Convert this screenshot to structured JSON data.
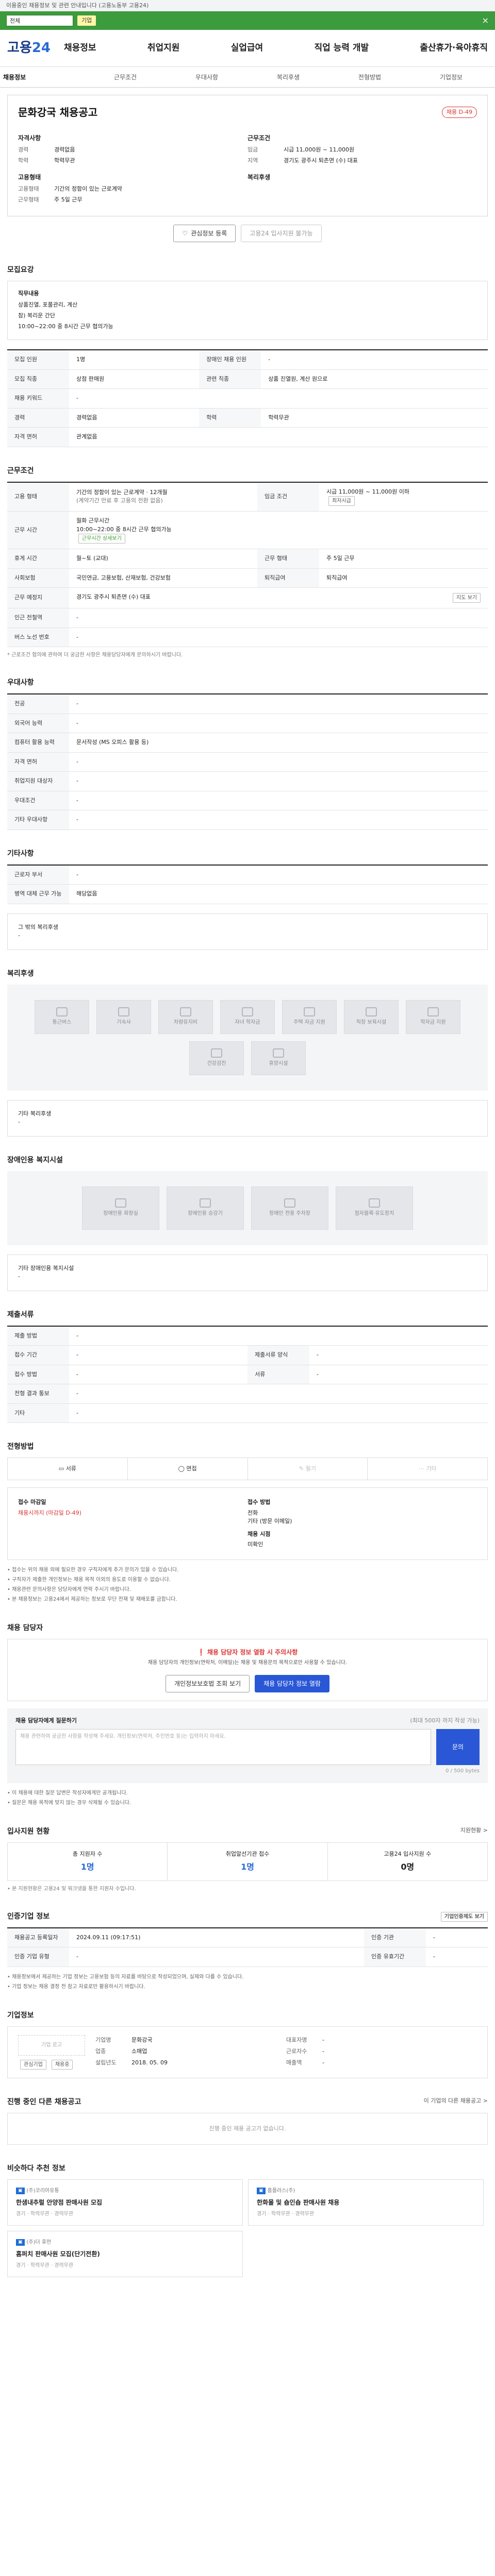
{
  "topbar": {
    "notice": "이용중인 채용정보 및 관련 안내입니다 (고용노동부 고용24)"
  },
  "greenbar": {
    "select_value": "전체",
    "tag": "기업",
    "close": "×"
  },
  "header": {
    "logo_a": "고용",
    "logo_b": "24",
    "menu": [
      "채용정보",
      "취업지원",
      "실업급여",
      "직업 능력 개발",
      "출산휴가·육아휴직"
    ]
  },
  "tabs": [
    "채용정보",
    "근무조건",
    "우대사항",
    "복리후생",
    "전형방법",
    "기업정보"
  ],
  "job": {
    "title": "문화강국 채용공고",
    "badge": "채용 D-49",
    "left": [
      {
        "group": "자격사항",
        "rows": [
          {
            "k": "경력",
            "v": "경력없음"
          },
          {
            "k": "학력",
            "v": "학력무관"
          }
        ]
      },
      {
        "group": "고용형태",
        "rows": [
          {
            "k": "고용형태",
            "v": "기간의 정함이 있는 근로계약"
          },
          {
            "k": "근무형태",
            "v": "주 5일 근무"
          }
        ]
      }
    ],
    "right": [
      {
        "group": "근무조건",
        "rows": [
          {
            "k": "임금",
            "v": "시급 11,000원 ~ 11,000원"
          },
          {
            "k": "지역",
            "v": "경기도 광주시 퇴촌면 (수) 대표"
          }
        ]
      },
      {
        "group": "복리후생",
        "rows": []
      }
    ],
    "btn_interest": "관심정보 등록",
    "btn_apply": "고용24 입사지원 불가능"
  },
  "summary": {
    "heading": "모집요강",
    "label": "직무내용",
    "lines": [
      "상품진열, 포풀관리, 계산",
      "참) 복리운 간단",
      "10:00~22:00 중 8시간 근무 협의가능"
    ]
  },
  "summary_table": [
    {
      "k": "모집 인원",
      "v": "1명",
      "k2": "장애인 채용 인원",
      "v2": "-"
    },
    {
      "k": "모집 직종",
      "v": "상점 판매원",
      "k2": "관련 직종",
      "v2": "상품 진열원, 계산 원으로"
    },
    {
      "k": "채용 키워드",
      "v": "-",
      "k2": "",
      "v2": ""
    },
    {
      "k": "경력",
      "v": "경력없음",
      "k2": "학력",
      "v2": "학력무관"
    },
    {
      "k": "자격 면허",
      "v": "관계없음",
      "k2": "",
      "v2": ""
    }
  ],
  "conditions": {
    "heading": "근무조건",
    "employ_type": "기간의 정함이 있는 근로계약 · 12개월",
    "employ_sub": "(계약기간 만료 후 고용의 전환 없음)",
    "wage": "시급 11,000원 ~ 11,000원 이하",
    "wage_chip": "최저시급",
    "hours_title": "월화 근무시간",
    "hours_line": "10:00~22:00 중 8시간 근무 협의가능",
    "hours_link": "근무시간 상세보기",
    "days": "주 5일 근무",
    "workday": "월~토 (교대)",
    "work_hours_k": "근로시간",
    "weekly_hours": "주 40시간",
    "insurance": "국민연금, 고용보험, 산재보험, 건강보험",
    "retire": "퇴직급여",
    "location": "경기도 광주시 퇴촌면 (수) 대표",
    "map_btn": "지도 보기",
    "subway": "-",
    "bus": "-",
    "note": "* 근로조건 협의에 관하여 더 궁금한 사항은 채용담당자에게 문의하시기 바랍니다."
  },
  "prefs": {
    "heading": "우대사항",
    "rows": [
      {
        "k": "전공",
        "v": "-"
      },
      {
        "k": "외국어 능력",
        "v": "-"
      },
      {
        "k": "컴퓨터 활용 능력",
        "v": "문서작성 (MS 오피스 활용 등)"
      },
      {
        "k": "자격 면허",
        "v": "-"
      },
      {
        "k": "취업지원 대상자",
        "v": "-"
      },
      {
        "k": "우대조건",
        "v": "-"
      },
      {
        "k": "기타 우대사항",
        "v": "-"
      }
    ]
  },
  "other": {
    "heading": "기타사항",
    "rows": [
      {
        "k": "근로자 부서",
        "v": "-"
      },
      {
        "k": "병역 대체 근무 가능",
        "v": "해당없음"
      }
    ]
  },
  "other_box": {
    "label": "그 밖의 복리후생",
    "value": "-"
  },
  "welfare": {
    "heading": "복리후생",
    "items": [
      "통근버스",
      "기숙사",
      "차량유지비",
      "자녀 학자금",
      "주택 자금 지원",
      "직장 보육시설",
      "학자금 지원",
      "건강검진",
      "휴양시설"
    ],
    "etc_label": "기타 복리후생",
    "etc_value": "-"
  },
  "disability": {
    "heading": "장애인용 복지시설",
    "items": [
      "장애인용 화장실",
      "장애인용 승강기",
      "장애인 전용 주차장",
      "점자블록·유도장치"
    ],
    "etc_label": "기타 장애인용 복지시설",
    "etc_value": "-"
  },
  "doc": {
    "heading": "제출서류",
    "rows": [
      {
        "k": "제출 방법",
        "v": "-",
        "k2": "",
        "v2": ""
      },
      {
        "k": "접수 기간",
        "v": "-",
        "k2": "제출서류 양식",
        "v2": "-"
      },
      {
        "k": "접수 방법",
        "v": "-",
        "k2": "서류",
        "v2": "-"
      },
      {
        "k": "전형 결과 통보",
        "v": "-",
        "k2": "",
        "v2": ""
      },
      {
        "k": "기타",
        "v": "-",
        "k2": "",
        "v2": ""
      }
    ]
  },
  "method": {
    "heading": "전형방법",
    "items": [
      {
        "label": "서류",
        "off": false
      },
      {
        "label": "면접",
        "off": false
      },
      {
        "label": "필기",
        "off": true
      },
      {
        "label": "기타",
        "off": true
      }
    ],
    "apply_title": "접수 마감일",
    "apply_value": "채용시까지 (마감일 D-49)",
    "apply2_title": "접수 방법",
    "apply2_values": [
      "전화",
      "기타 (방문 이메일)"
    ],
    "apply3_title": "채용 시점",
    "apply3_value": "미확인",
    "notes": [
      "• 접수는 위의 채용 외에 필요한 경우 구직자에게 추가 문의가 있을 수 있습니다.",
      "• 구직자가 제출한 개인정보는 채용 목적 이외의 용도로 이용할 수 없습니다.",
      "• 채용관련 문의사항은 담당자에게 연락 주시기 바랍니다.",
      "• 본 채용정보는 고용24에서 제공하는 정보로 무단 전재 및 재배포를 금합니다."
    ]
  },
  "manager": {
    "heading": "채용 담당자",
    "warn_title": "채용 담당자 정보 열람 시 주의사항",
    "warn_text": "채용 담당자의 개인정보(연락처, 이메일)는 채용 및 채용문의 목적으로만 사용할 수 있습니다.",
    "btn_view": "채용 담당자 정보 열람",
    "btn_contact": "개인정보보호법 조회 보기",
    "inquiry_title": "채용 담당자에게 질문하기",
    "inquiry_sub": "(최대 500자 까지 작성 가능)",
    "placeholder": "채용 관련하여 궁금한 사항을 작성해 주세요. 개인정보(연락처, 주민번호 등)는 입력하지 마세요.",
    "submit": "문의",
    "count": "0 / 500 bytes",
    "notes": [
      "• 이 채용에 대한 질문 답변은 작성자에게만 공개됩니다.",
      "• 질문은 채용 목적에 맞지 않는 경우 삭제될 수 있습니다."
    ]
  },
  "status": {
    "heading": "입사지원 현황",
    "link": "지원현황 >",
    "items": [
      {
        "label": "총 지원자 수",
        "value": "1명"
      },
      {
        "label": "취업알선기관 접수 ",
        "value": "1명"
      },
      {
        "label": "고용24 입사지원 수",
        "value": "0명"
      }
    ],
    "note": "• 본 지원현황은 고용24 및 워크넷을 통한 지원자 수입니다."
  },
  "info": {
    "heading": "인증기업 정보",
    "btn": "기업인증제도 보기",
    "rows": [
      {
        "k": "채용공고 등록일자",
        "v": "2024.09.11 (09:17:51)",
        "k2": "인증 기관",
        "v2": "-"
      },
      {
        "k": "인증 기업 유형",
        "v": "-",
        "k2": "인증 유효기간",
        "v2": "-"
      }
    ],
    "notes": [
      "• 채용정보에서 제공하는 기업 정보는 고용보험 등의 자료를 바탕으로 작성되었으며, 실제와 다를 수 있습니다.",
      "• 기업 정보는 채용 결정 전 참고 자료로만 활용하시기 바랍니다."
    ]
  },
  "company": {
    "heading": "기업정보",
    "logo_ph": "기업 로고",
    "btn_interest": "관심기업",
    "btn_more": "채용중",
    "rows": [
      {
        "k": "기업명",
        "v": "문화강국"
      },
      {
        "k": "대표자명",
        "v": "-"
      },
      {
        "k": "업종",
        "v": "소매업"
      },
      {
        "k": "근로자수",
        "v": "-"
      },
      {
        "k": "설립년도",
        "v": "2018. 05. 09"
      },
      {
        "k": "매출액",
        "v": "-"
      }
    ]
  },
  "related": {
    "heading": "진행 중인 다른 채용공고",
    "link": "이 기업의 다른 채용공고 >",
    "empty": "진행 중인 채용 공고가 없습니다."
  },
  "similar": {
    "heading": "비슷하다 추천 정보",
    "cards": [
      {
        "co": "(주)코리아유통",
        "title": "한샘내추럴 안양점 판매사원 모집",
        "meta": "경기 · 학력무관 · 경력무관"
      },
      {
        "co": "홈플러스(주)",
        "title": "한화몰 및 숍인숍 판매사원 채용",
        "meta": "경기 · 학력무관 · 경력무관"
      },
      {
        "co": "(주)더 휴먼",
        "title": "홈퍼치 판매사원 모집(단기전환)",
        "meta": "경기 · 학력무관 · 경력무관"
      }
    ]
  }
}
